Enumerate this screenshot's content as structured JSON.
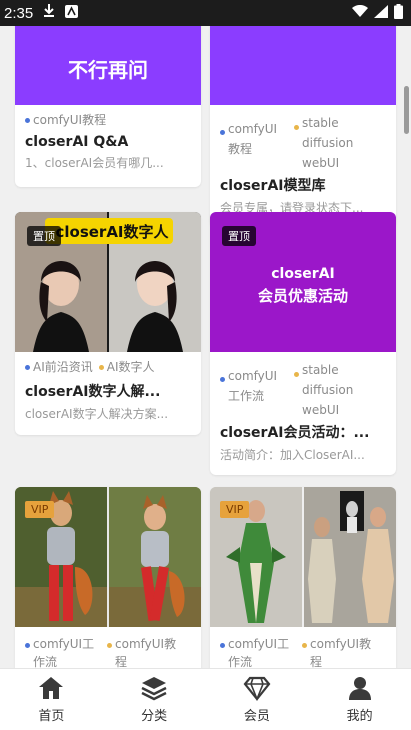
{
  "status_bar": {
    "time": "2:35"
  },
  "cards": [
    {
      "banner": "不行再问",
      "tags": [
        "comfyUI教程"
      ],
      "title": "closerAI Q&A",
      "desc": "1、closerAI会员有哪几..."
    },
    {
      "tags": [
        "comfyUI教程",
        "stable diffusion webUI"
      ],
      "title": "closerAI模型库",
      "desc": "会员专属，请登录状态下..."
    },
    {
      "pin_label": "置顶",
      "banner": "closerAI数字人",
      "tags": [
        "AI前沿资讯",
        "AI数字人"
      ],
      "title": "closerAI数字人解...",
      "desc": "closerAI数字人解决方案..."
    },
    {
      "pin_label": "置顶",
      "banner_line1": "closerAI",
      "banner_line2": "会员优惠活动",
      "tags": [
        "comfyUI工作流",
        "stable diffusion webUI"
      ],
      "title": "closerAI会员活动：...",
      "desc": "活动简介：加入CloserAI..."
    },
    {
      "vip_label": "VIP",
      "tags": [
        "comfyUI工作流",
        "comfyUI教程"
      ]
    },
    {
      "vip_label": "VIP",
      "tags": [
        "comfyUI工作流",
        "comfyUI教程"
      ]
    }
  ],
  "nav": [
    {
      "label": "首页",
      "icon": "home-icon"
    },
    {
      "label": "分类",
      "icon": "layers-icon"
    },
    {
      "label": "会员",
      "icon": "diamond-icon"
    },
    {
      "label": "我的",
      "icon": "user-icon"
    }
  ],
  "colors": {
    "purple": "#8b3dff",
    "violet": "#9b17c9",
    "yellow": "#f5d400"
  }
}
